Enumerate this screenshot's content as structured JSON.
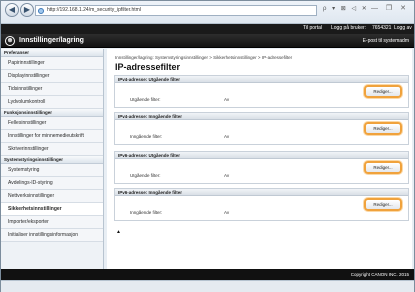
{
  "browser": {
    "url": "http://192.168.1.24/m_security_ipfilter.html",
    "window_controls": "— ❐ ✕",
    "toolbar_icons": "ρ ▾ ⊠ ◁ ✕"
  },
  "topbar": {
    "portal": "Til portal",
    "logout": "Logg på bruker:",
    "user": "7654321",
    "logout2": "Logg av"
  },
  "header": {
    "title": "Innstillinger/lagring",
    "mail": "E-post til systemadm"
  },
  "sidebar": {
    "groups": [
      {
        "label": "Preferanser",
        "items": [
          "Papirinnstillinger",
          "Displayinnstillinger",
          "Tidsinnstillinger",
          "Lydvolumkontroll"
        ]
      },
      {
        "label": "Funksjonsinnstillinger",
        "items": [
          "Fellesinnstillinger",
          "Innstillinger for minnemedieutskrift",
          "Skriverinnstillinger"
        ]
      },
      {
        "label": "Systemstyringsinnstillinger",
        "items": [
          "Systemstyring",
          "Avdelings-ID-styring",
          "Nettverksinnstillinger",
          "Sikkerhetsinnstillinger",
          "Importer/eksporter",
          "Initialiser innstillingsinformasjon"
        ]
      }
    ]
  },
  "main": {
    "breadcrumb": "Innstillinger/lagring: Systemstyringsinnstillinger > Sikkerhetsinnstillinger > IP-adressefilter",
    "title": "IP-adressefilter",
    "sections": [
      {
        "heading": "IPv4-adresse: Utgående filter",
        "label": "Utgående filter:",
        "value": "Av",
        "button": "Rediger..."
      },
      {
        "heading": "IPv4-adresse: Inngående filter",
        "label": "Inngående filter:",
        "value": "Av",
        "button": "Rediger..."
      },
      {
        "heading": "IPv6-adresse: Utgående filter",
        "label": "Utgående filter:",
        "value": "Av",
        "button": "Rediger..."
      },
      {
        "heading": "IPv6-adresse: Inngående filter",
        "label": "Inngående filter:",
        "value": "Av",
        "button": "Rediger..."
      }
    ],
    "to_top": "▲"
  },
  "footer": {
    "copyright": "Copyright CANON INC. 2015"
  },
  "colors": {
    "header_bg": "#1a1a1a",
    "button_highlight": "#f0a23c",
    "sidebar_bg": "#eef2f6"
  }
}
